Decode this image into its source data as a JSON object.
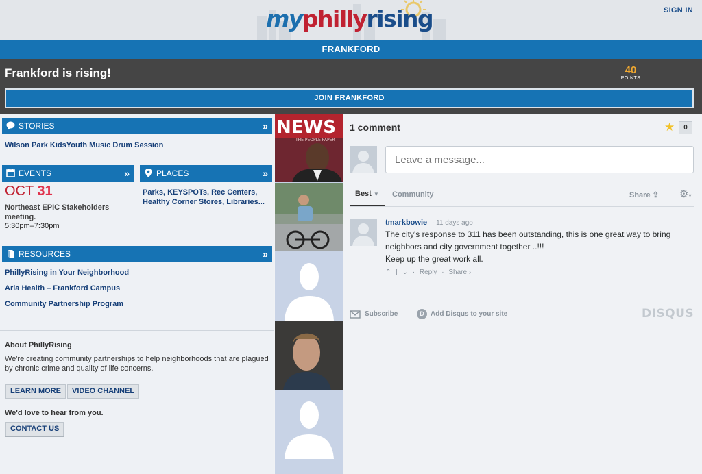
{
  "header": {
    "logo": {
      "my": "my",
      "philly": "philly",
      "rising": "rising"
    },
    "signin": "SIGN IN",
    "neighborhood": "FRANKFORD"
  },
  "banner": {
    "title": "Frankford is rising!",
    "points_value": "40",
    "points_label": "POINTS",
    "join_label": "JOIN FRANKFORD"
  },
  "stories": {
    "heading": "STORIES",
    "items": [
      "Wilson Park KidsYouth Music Drum Session"
    ]
  },
  "events": {
    "heading": "EVENTS",
    "month": "OCT",
    "day": "31",
    "title": "Northeast EPIC Stakeholders meeting.",
    "time": "5:30pm–7:30pm"
  },
  "places": {
    "heading": "PLACES",
    "text": "Parks, KEYSPOTs, Rec Centers, Healthy Corner Stores, Libraries..."
  },
  "resources": {
    "heading": "RESOURCES",
    "items": [
      "PhillyRising in Your Neighborhood",
      "Aria Health – Frankford Campus",
      "Community Partnership Program"
    ]
  },
  "about": {
    "title": "About PhillyRising",
    "text": "We're creating community partnerships to help neighborhoods that are plagued by chronic crime and quality of life concerns.",
    "learn_more": "LEARN MORE",
    "video_channel": "VIDEO CHANNEL",
    "hear": "We'd love to hear from you.",
    "contact": "CONTACT US"
  },
  "photos": {
    "news_text": "NEWS",
    "news_subtext": "THE PEOPLE PAPER"
  },
  "disqus": {
    "count_label": "1 comment",
    "star_count": "0",
    "input_placeholder": "Leave a message...",
    "tab_best": "Best",
    "tab_community": "Community",
    "share": "Share",
    "comment": {
      "author": "tmarkbowie",
      "time": "11 days ago",
      "text1": "The city's response to 311 has been outstanding, this is one great way to bring neighbors and city government together ..!!!",
      "text2": "Keep up the great work all.",
      "reply": "Reply",
      "share": "Share ›"
    },
    "subscribe": "Subscribe",
    "add_disqus": "Add Disqus to your site",
    "brand": "DISQUS"
  },
  "colors": {
    "primary_blue": "#1673b4",
    "dark_bar": "#454545",
    "accent_red": "#c02232",
    "points_orange": "#f0a830",
    "link_blue": "#163f78"
  }
}
